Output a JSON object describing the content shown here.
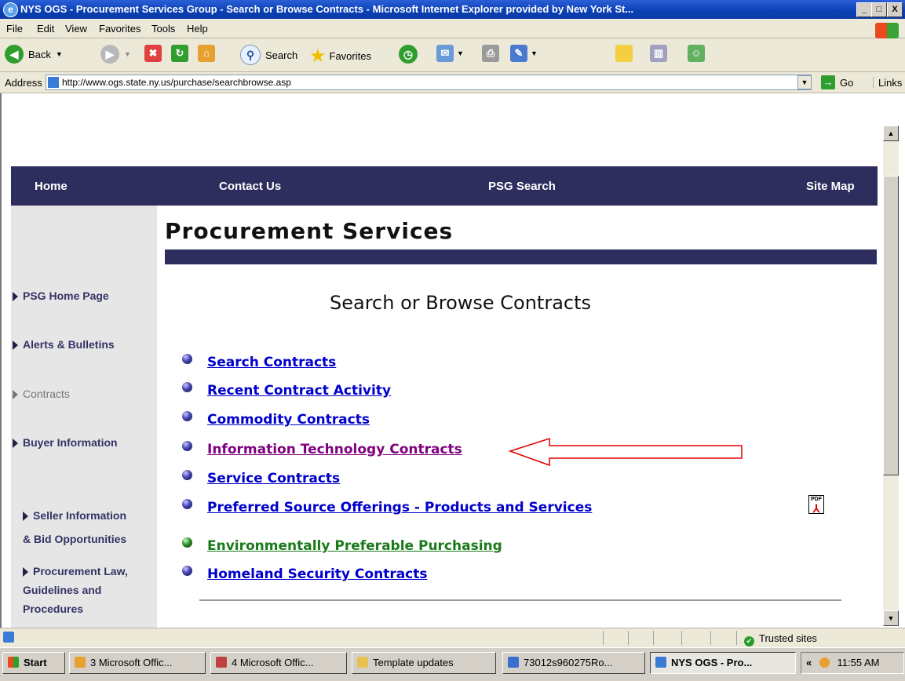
{
  "window": {
    "title": "NYS OGS - Procurement Services Group - Search or Browse Contracts - Microsoft Internet Explorer provided by New York St...",
    "buttons": [
      "_",
      "□",
      "X"
    ]
  },
  "menu": [
    "File",
    "Edit",
    "View",
    "Favorites",
    "Tools",
    "Help"
  ],
  "toolbar": {
    "back": "Back",
    "search": "Search",
    "favorites": "Favorites"
  },
  "address": {
    "label": "Address",
    "url": "http://www.ogs.state.ny.us/purchase/searchbrowse.asp",
    "go": "Go",
    "links": "Links"
  },
  "nav": {
    "home": "Home",
    "contact": "Contact Us",
    "search": "PSG Search",
    "sitemap": "Site Map"
  },
  "left_nav": [
    {
      "label": "PSG Home Page",
      "active": true
    },
    {
      "label": "Alerts & Bulletins",
      "active": true
    },
    {
      "label": "Contracts",
      "active": false
    },
    {
      "label": "Buyer Information",
      "active": true
    },
    {
      "label": "Seller Information\n& Bid Opportunities",
      "active": true
    },
    {
      "label": "Procurement Law,\nGuidelines and\nProcedures",
      "active": true
    }
  ],
  "page": {
    "title": "Procurement Services",
    "subtitle": "Search or Browse Contracts"
  },
  "links": [
    {
      "label": "Search Contracts",
      "style": "normal"
    },
    {
      "label": "Recent Contract Activity",
      "style": "normal"
    },
    {
      "label": "Commodity Contracts",
      "style": "normal"
    },
    {
      "label": "Information Technology Contracts",
      "style": "visited"
    },
    {
      "label": "Service Contracts",
      "style": "normal"
    },
    {
      "label": "Preferred Source Offerings - Products and Services",
      "style": "normal"
    },
    {
      "label": "Environmentally Preferable Purchasing",
      "style": "green"
    },
    {
      "label": "Homeland Security Contracts",
      "style": "normal"
    }
  ],
  "pdf_icon": "PDF",
  "status": {
    "zone": "Trusted sites"
  },
  "taskbar": {
    "start": "Start",
    "tasks": [
      {
        "label": "3 Microsoft Offic...",
        "icon_color": "#e8a030",
        "active": false
      },
      {
        "label": "4 Microsoft Offic...",
        "icon_color": "#c04040",
        "active": false
      },
      {
        "label": "Template updates",
        "icon_color": "#e8c050",
        "active": false
      },
      {
        "label": "73012s960275Ro...",
        "icon_color": "#3a6fd0",
        "active": false
      },
      {
        "label": "NYS OGS - Pro...",
        "icon_color": "#3a7bd5",
        "active": true
      }
    ],
    "clock": "11:55 AM"
  },
  "colors": {
    "nav_bg": "#2e2e5e",
    "link": "#0000cc",
    "visited": "#800080",
    "green_link": "#1a7a1a",
    "annotation_arrow": "#e00000"
  }
}
